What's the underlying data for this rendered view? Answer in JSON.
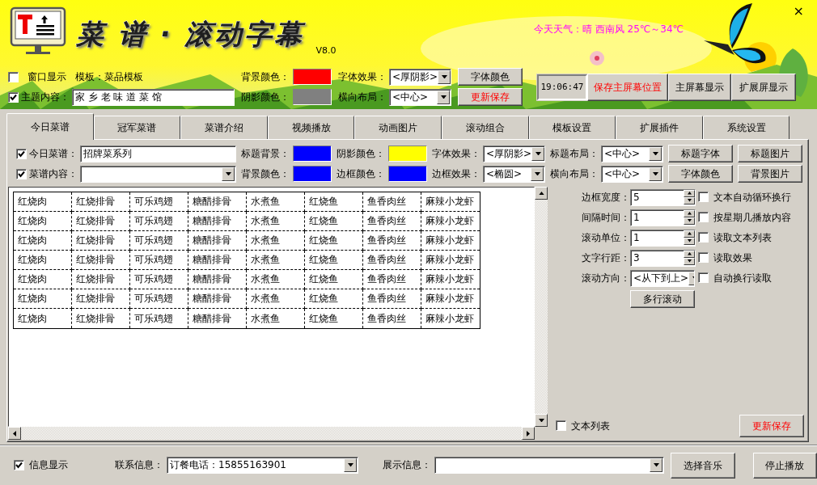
{
  "header": {
    "title": "菜 谱 · 滚动字幕",
    "version": "V8.0",
    "weather": "今天天气：晴 西南风 25℃～34℃",
    "close": "×",
    "clock": "19:06:47"
  },
  "header_rows": [
    [
      {
        "kind": "check_text",
        "label": "窗口显示",
        "checked": false,
        "note": "模板：菜品模板"
      },
      {
        "kind": "swatch",
        "label": "背景颜色：",
        "color": "#ff0000"
      },
      {
        "kind": "select",
        "label": "字体效果：",
        "value": "<厚阴影>"
      },
      {
        "kind": "button",
        "label": "字体颜色",
        "emphasis": false
      }
    ],
    [
      {
        "kind": "check_field",
        "label": "主题内容：",
        "checked": true,
        "value": "家 乡 老 味 道 菜 馆"
      },
      {
        "kind": "swatch",
        "label": "阴影颜色：",
        "color": "#808080"
      },
      {
        "kind": "select",
        "label": "横向布局：",
        "value": "<中心>"
      },
      {
        "kind": "button",
        "label": "更新保存",
        "emphasis": true
      }
    ]
  ],
  "screen_buttons": [
    {
      "label": "保存主屏幕位置",
      "emphasis": true
    },
    {
      "label": "主屏幕显示",
      "emphasis": false
    },
    {
      "label": "扩展屏显示",
      "emphasis": false
    }
  ],
  "tabs": [
    {
      "label": "今日菜谱",
      "selected": true
    },
    {
      "label": "冠军菜谱",
      "selected": false
    },
    {
      "label": "菜谱介绍",
      "selected": false
    },
    {
      "label": "视频播放",
      "selected": false
    },
    {
      "label": "动画图片",
      "selected": false
    },
    {
      "label": "滚动组合",
      "selected": false
    },
    {
      "label": "模板设置",
      "selected": false
    },
    {
      "label": "扩展插件",
      "selected": false
    },
    {
      "label": "系统设置",
      "selected": false
    }
  ],
  "panel_rows": [
    [
      {
        "kind": "check_field",
        "label": "今日菜谱：",
        "checked": true,
        "value": "招牌菜系列"
      },
      {
        "kind": "swatch",
        "label": "标题背景：",
        "color": "#0000ff"
      },
      {
        "kind": "swatch",
        "label": "阴影颜色：",
        "color": "#ffff00"
      },
      {
        "kind": "select",
        "label": "字体效果：",
        "value": "<厚阴影>"
      },
      {
        "kind": "select",
        "label": "标题布局：",
        "value": "<中心>"
      },
      {
        "kind": "button",
        "label": "标题字体",
        "emphasis": false
      },
      {
        "kind": "button",
        "label": "标题图片",
        "emphasis": false
      }
    ],
    [
      {
        "kind": "check_select",
        "label": "菜谱内容：",
        "checked": true
      },
      {
        "kind": "swatch",
        "label": "背景颜色：",
        "color": "#0000ff"
      },
      {
        "kind": "swatch",
        "label": "边框颜色：",
        "color": "#0000ff"
      },
      {
        "kind": "select",
        "label": "边框效果：",
        "value": "<椭圆>"
      },
      {
        "kind": "select",
        "label": "横向布局：",
        "value": "<中心>"
      },
      {
        "kind": "button",
        "label": "字体颜色",
        "emphasis": false
      },
      {
        "kind": "button",
        "label": "背景图片",
        "emphasis": false
      }
    ]
  ],
  "menu_grid": [
    [
      "红烧肉",
      "红烧排骨",
      "可乐鸡翅",
      "糖醋排骨",
      "水煮鱼",
      "红烧鱼",
      "鱼香肉丝",
      "麻辣小龙虾"
    ],
    [
      "红烧肉",
      "红烧排骨",
      "可乐鸡翅",
      "糖醋排骨",
      "水煮鱼",
      "红烧鱼",
      "鱼香肉丝",
      "麻辣小龙虾"
    ],
    [
      "红烧肉",
      "红烧排骨",
      "可乐鸡翅",
      "糖醋排骨",
      "水煮鱼",
      "红烧鱼",
      "鱼香肉丝",
      "麻辣小龙虾"
    ],
    [
      "红烧肉",
      "红烧排骨",
      "可乐鸡翅",
      "糖醋排骨",
      "水煮鱼",
      "红烧鱼",
      "鱼香肉丝",
      "麻辣小龙虾"
    ],
    [
      "红烧肉",
      "红烧排骨",
      "可乐鸡翅",
      "糖醋排骨",
      "水煮鱼",
      "红烧鱼",
      "鱼香肉丝",
      "麻辣小龙虾"
    ],
    [
      "红烧肉",
      "红烧排骨",
      "可乐鸡翅",
      "糖醋排骨",
      "水煮鱼",
      "红烧鱼",
      "鱼香肉丝",
      "麻辣小龙虾"
    ],
    [
      "红烧肉",
      "红烧排骨",
      "可乐鸡翅",
      "糖醋排骨",
      "水煮鱼",
      "红烧鱼",
      "鱼香肉丝",
      "麻辣小龙虾"
    ]
  ],
  "side": {
    "fields": [
      {
        "kind": "spin",
        "label": "边框宽度：",
        "value": "5"
      },
      {
        "kind": "spin",
        "label": "间隔时间：",
        "value": "1"
      },
      {
        "kind": "spin",
        "label": "滚动单位：",
        "value": "1"
      },
      {
        "kind": "spin",
        "label": "文字行距：",
        "value": "3"
      },
      {
        "kind": "select",
        "label": "滚动方向：",
        "value": "<从下到上>"
      }
    ],
    "options": [
      {
        "label": "文本自动循环换行",
        "checked": false
      },
      {
        "label": "按星期几播放内容",
        "checked": false
      },
      {
        "label": "读取文本列表",
        "checked": false
      },
      {
        "label": "读取效果",
        "checked": false
      },
      {
        "label": "自动换行读取",
        "checked": false
      }
    ],
    "button": "多行滚动",
    "text_list": {
      "label": "文本列表",
      "checked": false
    },
    "save_button": "更新保存"
  },
  "footer": {
    "info": {
      "label": "信息显示",
      "checked": true
    },
    "contact": {
      "label": "联系信息：",
      "value": "订餐电话：15855163901"
    },
    "display": {
      "label": "展示信息："
    },
    "buttons": [
      "选择音乐",
      "停止播放"
    ]
  }
}
